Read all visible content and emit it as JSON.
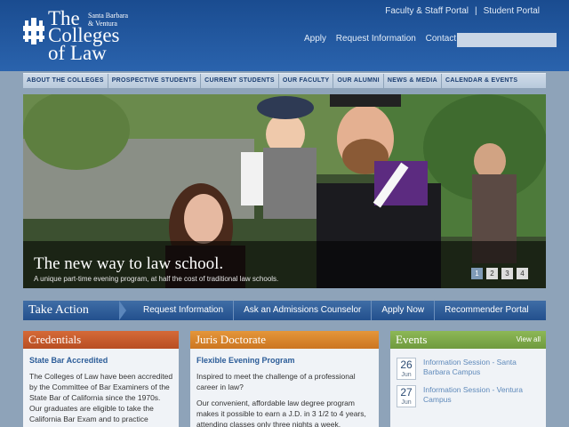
{
  "header": {
    "logo_the": "The",
    "logo_location_1": "Santa Barbara",
    "logo_location_2": "& Ventura",
    "logo_colleges": "Colleges",
    "logo_of_law": "of Law",
    "utility": [
      "Faculty & Staff Portal",
      "Student Portal"
    ],
    "utility_separator": "|",
    "links": [
      "Apply",
      "Request Information",
      "Contact Us"
    ],
    "search_placeholder": ""
  },
  "nav": [
    "ABOUT THE COLLEGES",
    "PROSPECTIVE STUDENTS",
    "CURRENT STUDENTS",
    "OUR FACULTY",
    "OUR ALUMNI",
    "NEWS & MEDIA",
    "CALENDAR & EVENTS"
  ],
  "hero": {
    "title": "The new way to law school.",
    "subtitle": "A unique part-time evening program, at half the cost of traditional law schools.",
    "pages": [
      "1",
      "2",
      "3",
      "4"
    ],
    "active_page": "1"
  },
  "take_action": {
    "title": "Take Action",
    "links": [
      "Request Information",
      "Ask an Admissions Counselor",
      "Apply Now",
      "Recommender Portal"
    ]
  },
  "credentials": {
    "title": "Credentials",
    "subtitle": "State Bar Accredited",
    "body": "The Colleges of Law have been accredited by the Committee of Bar Examiners of the State Bar of California since the 1970s. Our graduates are eligible to take the California Bar Exam and to practice"
  },
  "juris": {
    "title": "Juris Doctorate",
    "subtitle": "Flexible Evening Program",
    "body1": "Inspired to meet the challenge of a professional career in law?",
    "body2": "Our convenient, affordable law degree program makes it possible to earn a J.D. in 3 1/2 to 4 years, attending classes only three nights a week."
  },
  "events": {
    "title": "Events",
    "view_all": "View all",
    "items": [
      {
        "day": "26",
        "month": "Jun",
        "label": "Information Session - Santa Barbara Campus"
      },
      {
        "day": "27",
        "month": "Jun",
        "label": "Information Session - Ventura Campus"
      }
    ]
  },
  "colors": {
    "header_blue": "#1a4c90",
    "credentials_head": "#c75a2c",
    "juris_head": "#d9862a",
    "events_head": "#7ea84a"
  }
}
